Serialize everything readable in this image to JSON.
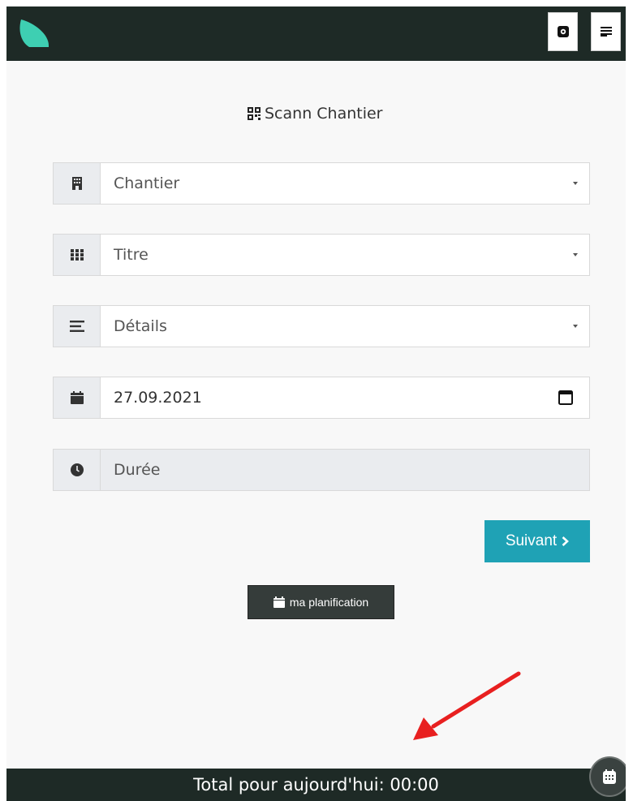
{
  "header": {
    "logo_icon": "leaf-logo",
    "settings_icon": "gear-icon",
    "menu_icon": "hamburger-icon"
  },
  "scan": {
    "label": "Scann Chantier",
    "icon": "qr-code-icon"
  },
  "form": {
    "chantier": {
      "placeholder": "Chantier",
      "icon": "building-icon"
    },
    "titre": {
      "placeholder": "Titre",
      "icon": "grid-icon"
    },
    "details": {
      "placeholder": "Détails",
      "icon": "lines-icon"
    },
    "date": {
      "value": "27.09.2021",
      "icon": "calendar-icon",
      "picker_icon": "calendar-outline-icon"
    },
    "duree": {
      "placeholder": "Durée",
      "icon": "clock-icon"
    }
  },
  "actions": {
    "next_label": "Suivant",
    "next_icon": "chevron-right-icon",
    "planning_label": "ma planification",
    "planning_icon": "calendar-icon"
  },
  "footer": {
    "total_label": "Total pour aujourd'hui: 00:00",
    "fab_icon": "calendar-keypad-icon"
  },
  "colors": {
    "topbar": "#1e2a26",
    "accent": "#1fa2b5",
    "logo": "#3ecfb2",
    "annotation_arrow": "#e82020"
  }
}
